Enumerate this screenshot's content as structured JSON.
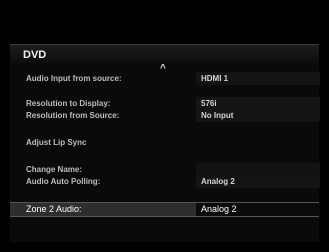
{
  "menu": {
    "title": "DVD",
    "scroll_up_glyph": "^",
    "rows": [
      {
        "label": "Audio Input from source:",
        "value": "HDMI 1"
      },
      {
        "label": "Resolution to Display:",
        "value": "576i"
      },
      {
        "label": "Resolution from Source:",
        "value": "No Input"
      },
      {
        "label": "Adjust Lip Sync",
        "value": ""
      },
      {
        "label": "Change Name:",
        "value": ""
      },
      {
        "label": "Audio Auto Polling:",
        "value": "Analog 2"
      }
    ],
    "selected": {
      "label": "Zone 2 Audio:",
      "value": "Analog 2"
    }
  }
}
